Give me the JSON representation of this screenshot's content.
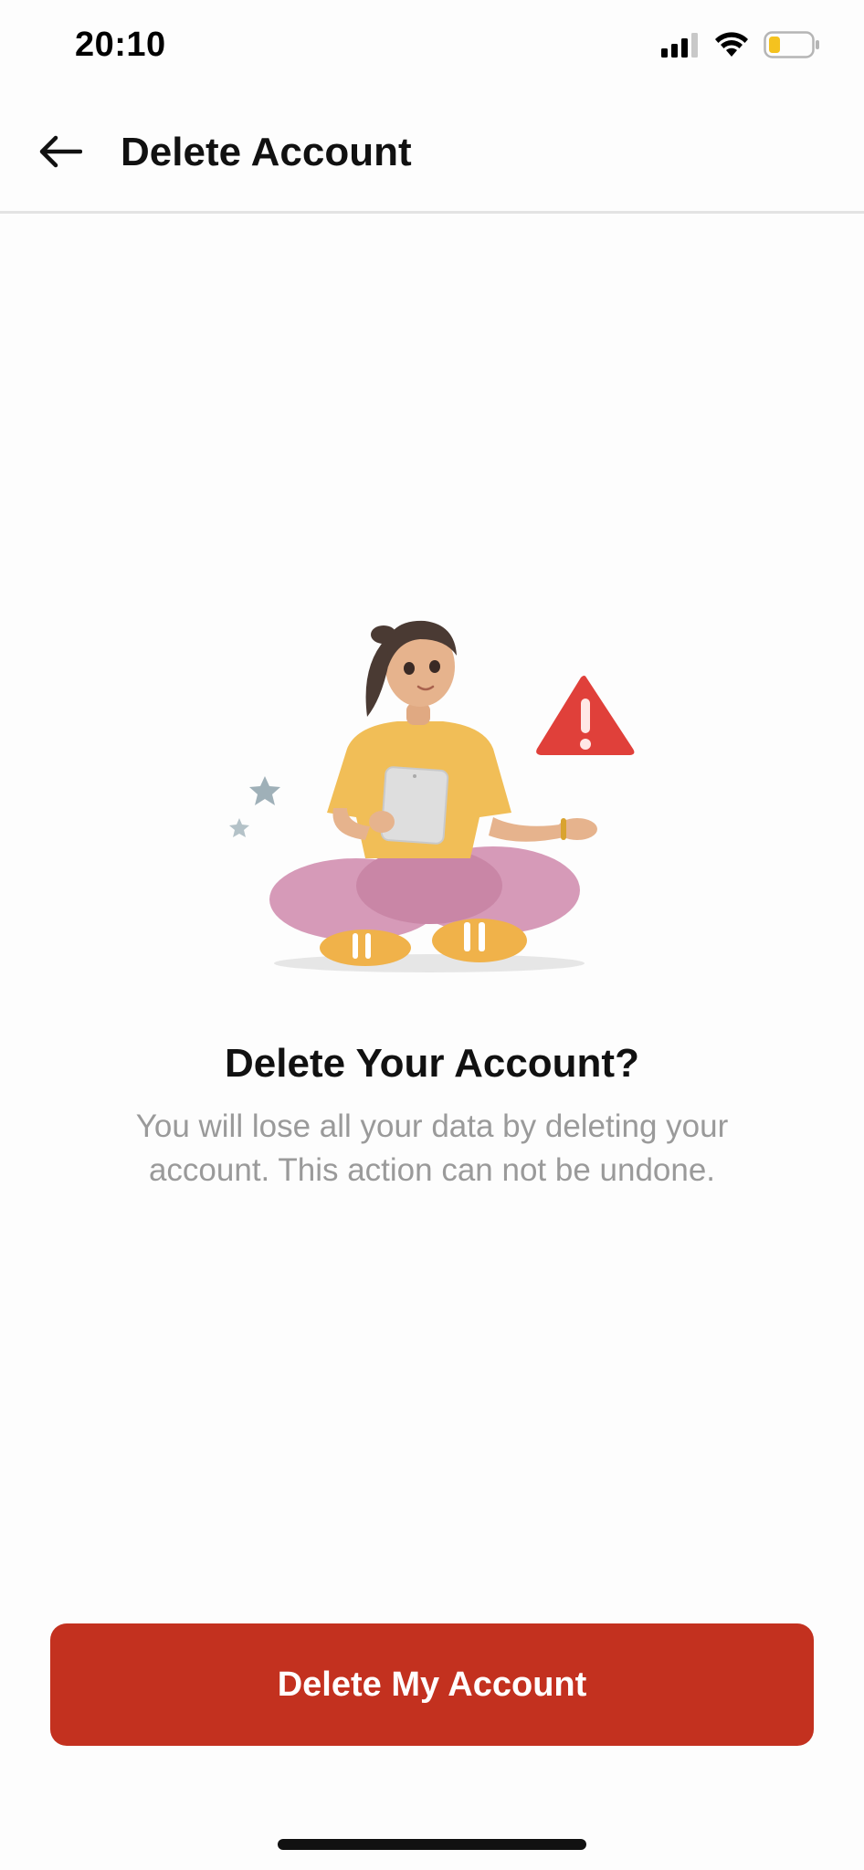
{
  "status_bar": {
    "time": "20:10",
    "icons": [
      "cellular-signal-icon",
      "wifi-icon",
      "battery-low-icon"
    ]
  },
  "header": {
    "back_icon": "arrow-left-icon",
    "title": "Delete Account"
  },
  "content": {
    "illustration": "person-with-tablet-and-warning-icon",
    "headline": "Delete Your Account?",
    "description": "You will lose all your data by deleting your account. This action can not be undone."
  },
  "actions": {
    "delete_label": "Delete My Account"
  },
  "colors": {
    "accent": "#c3311f",
    "description_text": "#9a9a9a",
    "divider": "#e3e3e3",
    "warning": "#e0403a"
  }
}
